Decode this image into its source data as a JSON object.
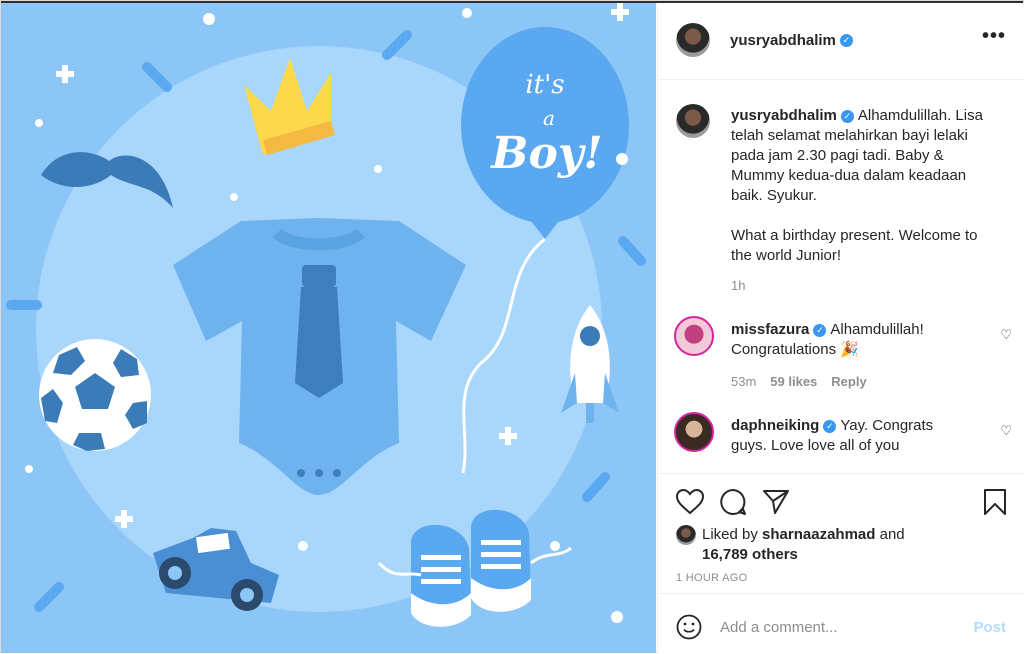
{
  "post": {
    "username": "yusryabdhalim",
    "more_label": "•••",
    "caption_line1": "Alhamdulillah. Lisa",
    "caption_line2": "telah selamat melahirkan bayi lelaki",
    "caption_line3": "pada jam 2.30 pagi tadi. Baby &",
    "caption_line4": "Mummy kedua-dua dalam keadaan",
    "caption_line5": "baik. Syukur.",
    "caption_line6": "What a birthday present. Welcome to",
    "caption_line7": "the world Junior!",
    "caption_time": "1h"
  },
  "image": {
    "balloon_line1": "it's",
    "balloon_line2": "a",
    "balloon_line3": "Boy!",
    "background_color": "#8cc6f7"
  },
  "comments": [
    {
      "username": "missfazura",
      "text_line1": "Alhamdulillah!",
      "text_line2": "Congratulations 🎉",
      "time": "53m",
      "likes": "59 likes",
      "reply": "Reply"
    },
    {
      "username": "daphneiking",
      "text_line1": "Yay. Congrats",
      "text_line2": "guys. Love love all of you"
    }
  ],
  "likes": {
    "prefix": "Liked by",
    "user": "sharnaazahmad",
    "and": "and",
    "count": "16,789 others"
  },
  "timestamp": "1 HOUR AGO",
  "add_comment": {
    "placeholder": "Add a comment...",
    "post_label": "Post"
  },
  "colors": {
    "accent": "#3897f0",
    "post_disabled": "#b3dbff",
    "muted": "#8e8e8e"
  }
}
